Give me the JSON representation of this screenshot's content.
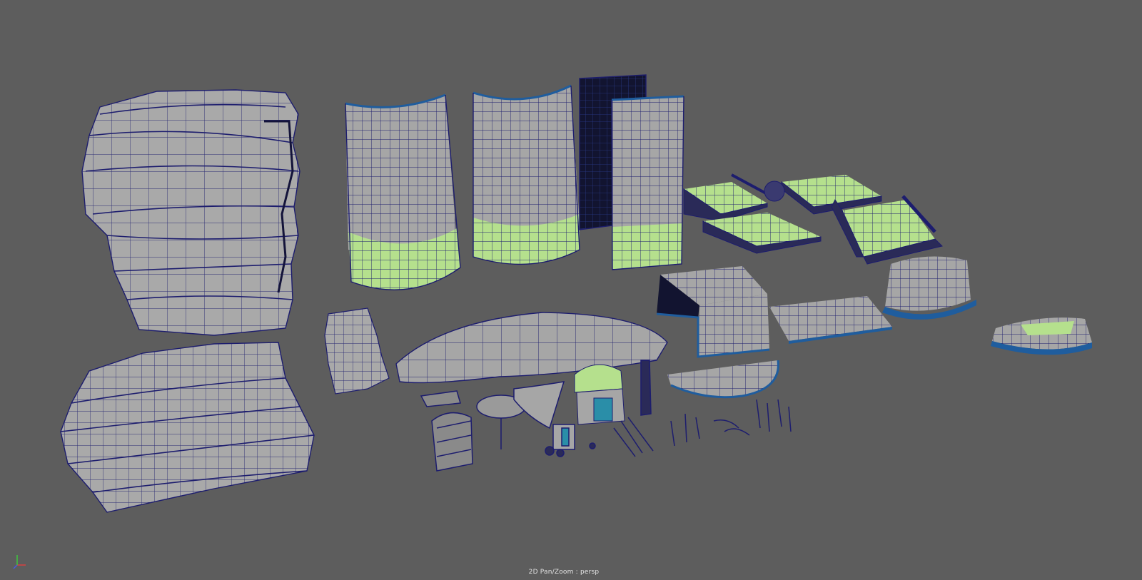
{
  "viewport": {
    "camera_label": "2D Pan/Zoom : persp",
    "background_color": "#5d5d5d",
    "wire_color": "#1d1d6e",
    "surface_color": "#a6a6a6",
    "selected_face_color": "#b5e08d",
    "edge_highlight_color": "#1f5d9e"
  },
  "axis_gizmo": {
    "x_color": "#d84040",
    "y_color": "#3fc43f",
    "z_color": "#4a5ce0"
  }
}
